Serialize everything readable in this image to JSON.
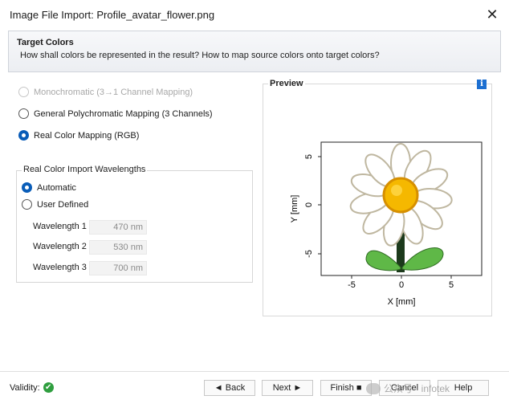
{
  "window": {
    "title": "Image File Import: Profile_avatar_flower.png"
  },
  "header": {
    "title": "Target Colors",
    "description": "How shall colors be represented in the result? How to map source colors onto target colors?"
  },
  "options": {
    "monochromatic": "Monochromatic (3→1 Channel Mapping)",
    "general_poly": "General Polychromatic Mapping (3 Channels)",
    "real_color": "Real Color Mapping (RGB)",
    "selected": "real_color"
  },
  "wavelengths": {
    "legend": "Real Color Import Wavelengths",
    "automatic": "Automatic",
    "user_defined": "User Defined",
    "selected": "automatic",
    "wl1_label": "Wavelength 1",
    "wl1_value": "470 nm",
    "wl2_label": "Wavelength 2",
    "wl2_value": "530 nm",
    "wl3_label": "Wavelength 3",
    "wl3_value": "700 nm"
  },
  "preview": {
    "legend": "Preview",
    "info_glyph": "i",
    "xlabel": "X [mm]",
    "ylabel": "Y [mm]",
    "x_ticks": [
      "-5",
      "0",
      "5"
    ],
    "y_ticks": [
      "5",
      "0",
      "-5"
    ]
  },
  "footer": {
    "validity_label": "Validity:",
    "validity_glyph": "✔",
    "back": "◄ Back",
    "next": "Next ►",
    "finish": "Finish ■",
    "cancel": "Cancel",
    "help": "Help",
    "watermark": "公众号 · infotek"
  },
  "colors": {
    "accent": "#0a5db8",
    "ok": "#2f9e3f",
    "info": "#1c6fd1"
  },
  "icons": [
    "close-icon",
    "info-icon",
    "ok-check-icon"
  ]
}
